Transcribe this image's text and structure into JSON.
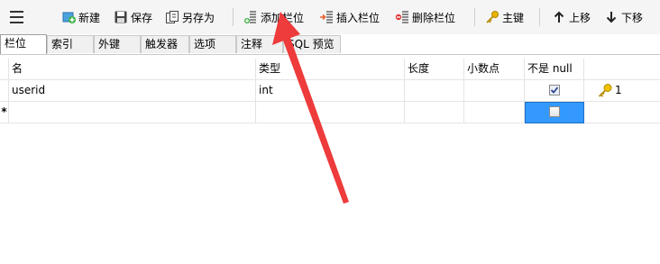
{
  "toolbar": {
    "new_label": "新建",
    "save_label": "保存",
    "save_as_label": "另存为",
    "add_field_label": "添加栏位",
    "insert_field_label": "插入栏位",
    "delete_field_label": "删除栏位",
    "primary_key_label": "主键",
    "move_up_label": "上移",
    "move_down_label": "下移"
  },
  "tabs": [
    {
      "label": "栏位"
    },
    {
      "label": "索引"
    },
    {
      "label": "外键"
    },
    {
      "label": "触发器"
    },
    {
      "label": "选项"
    },
    {
      "label": "注释"
    },
    {
      "label": "SQL 预览"
    }
  ],
  "grid": {
    "columns": [
      "名",
      "类型",
      "长度",
      "小数点",
      "不是 null",
      ""
    ],
    "rows": [
      {
        "marker": "",
        "name": "userid",
        "type": "int",
        "length": "",
        "decimals": "",
        "not_null": true,
        "key": "1"
      },
      {
        "marker": "*",
        "name": "",
        "type": "",
        "length": "",
        "decimals": "",
        "not_null": false,
        "key": ""
      }
    ]
  },
  "colors": {
    "arrow": "#ee3b3b",
    "selection": "#3399ff",
    "key_icon": "#e8b400"
  }
}
